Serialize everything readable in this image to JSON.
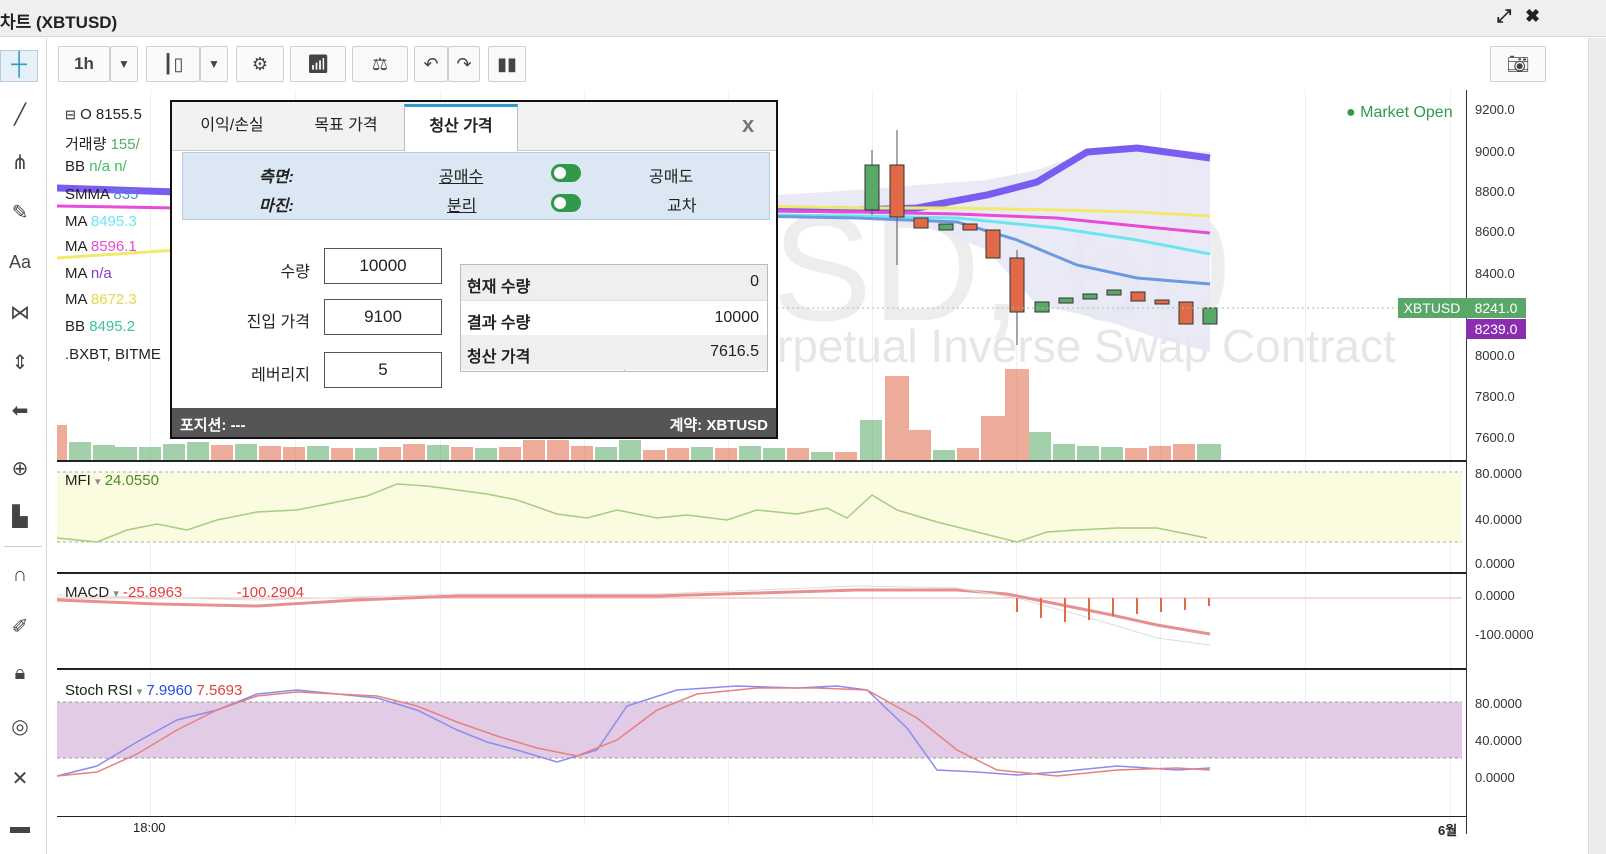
{
  "window": {
    "title": "차트 (XBTUSD)",
    "expand_icon": "expand-icon",
    "close_icon": "close-icon"
  },
  "toolbar": {
    "interval": "1h",
    "buttons": [
      "interval-dropdown",
      "candle-style-button",
      "style-dropdown",
      "settings-icon",
      "indicators-icon",
      "compare-icon",
      "undo-icon",
      "redo-icon",
      "bar-chart-icon",
      "camera-icon"
    ]
  },
  "left_tools": [
    "crosshair-icon",
    "trendline-icon",
    "pitchfork-icon",
    "brush-icon",
    "text-icon",
    "pattern-icon",
    "measure-icon",
    "arrow-left-icon",
    "zoom-icon",
    "ruler-icon",
    "magnet-icon",
    "pencil-lock-icon",
    "lock-icon",
    "eye-icon",
    "remove-icon",
    "trash-icon"
  ],
  "chart": {
    "watermark_symbol": "SD, 60",
    "watermark_desc": "rpetual Inverse Swap Contract",
    "market_status": "● Market Open",
    "price_tag": "XBTUSD",
    "price_last": "8241.0",
    "price_tag2": "8239.0",
    "legend": [
      {
        "label": "O",
        "value": "8155.5"
      },
      {
        "label": "거래량",
        "value": "155/"
      },
      {
        "label": "BB",
        "value": "n/a  n/"
      },
      {
        "label": "SMMA",
        "value": "835"
      },
      {
        "label": "MA",
        "value": "8495.3"
      },
      {
        "label": "MA",
        "value": "8596.1"
      },
      {
        "label": "MA",
        "value": "n/a"
      },
      {
        "label": "MA",
        "value": "8672.3"
      },
      {
        "label": "BB",
        "value": "8495.2"
      },
      {
        "label": ".BXBT, BITME",
        "value": ""
      }
    ],
    "y_axis": [
      "9200.0",
      "9000.0",
      "8800.0",
      "8600.0",
      "8400.0",
      "8200.0",
      "8000.0",
      "7800.0",
      "7600.0"
    ],
    "x_axis": [
      "18:00",
      "6월"
    ]
  },
  "mfi": {
    "label": "MFI",
    "value": "24.0550",
    "y_axis": [
      "80.0000",
      "40.0000",
      "0.0000"
    ]
  },
  "macd": {
    "label": "MACD",
    "v1": "-25.8963",
    "v2": "-100.2904",
    "y_axis": [
      "0.0000",
      "-100.0000"
    ]
  },
  "stoch": {
    "label": "Stoch RSI",
    "k": "7.9960",
    "d": "7.5693",
    "y_axis": [
      "80.0000",
      "40.0000",
      "0.0000"
    ]
  },
  "dialog": {
    "tabs": [
      "이익/손실",
      "목표 가격",
      "청산 가격"
    ],
    "active_tab": 2,
    "close": "x",
    "side_label": "측면:",
    "side_left": "공매수",
    "side_right": "공매도",
    "margin_label": "마진:",
    "margin_left": "분리",
    "margin_right": "교차",
    "fields": [
      {
        "label": "수량",
        "value": "10000"
      },
      {
        "label": "진입 가격",
        "value": "9100"
      },
      {
        "label": "레버리지",
        "value": "5"
      }
    ],
    "results": [
      {
        "label": "현재 수량",
        "value": "0"
      },
      {
        "label": "결과 수량",
        "value": "10000"
      },
      {
        "label": "청산 가격",
        "value": "7616.5"
      }
    ],
    "footer_left": "포지션: ---",
    "footer_right": "계약: XBTUSD"
  },
  "colors": {
    "up": "#5aa868",
    "down": "#e06a48",
    "bb_fill": "#e4e4f4",
    "smma": "#7b5cf0",
    "stoch_band": "#e2cbe5",
    "mfi_band": "#fbfbe0"
  }
}
